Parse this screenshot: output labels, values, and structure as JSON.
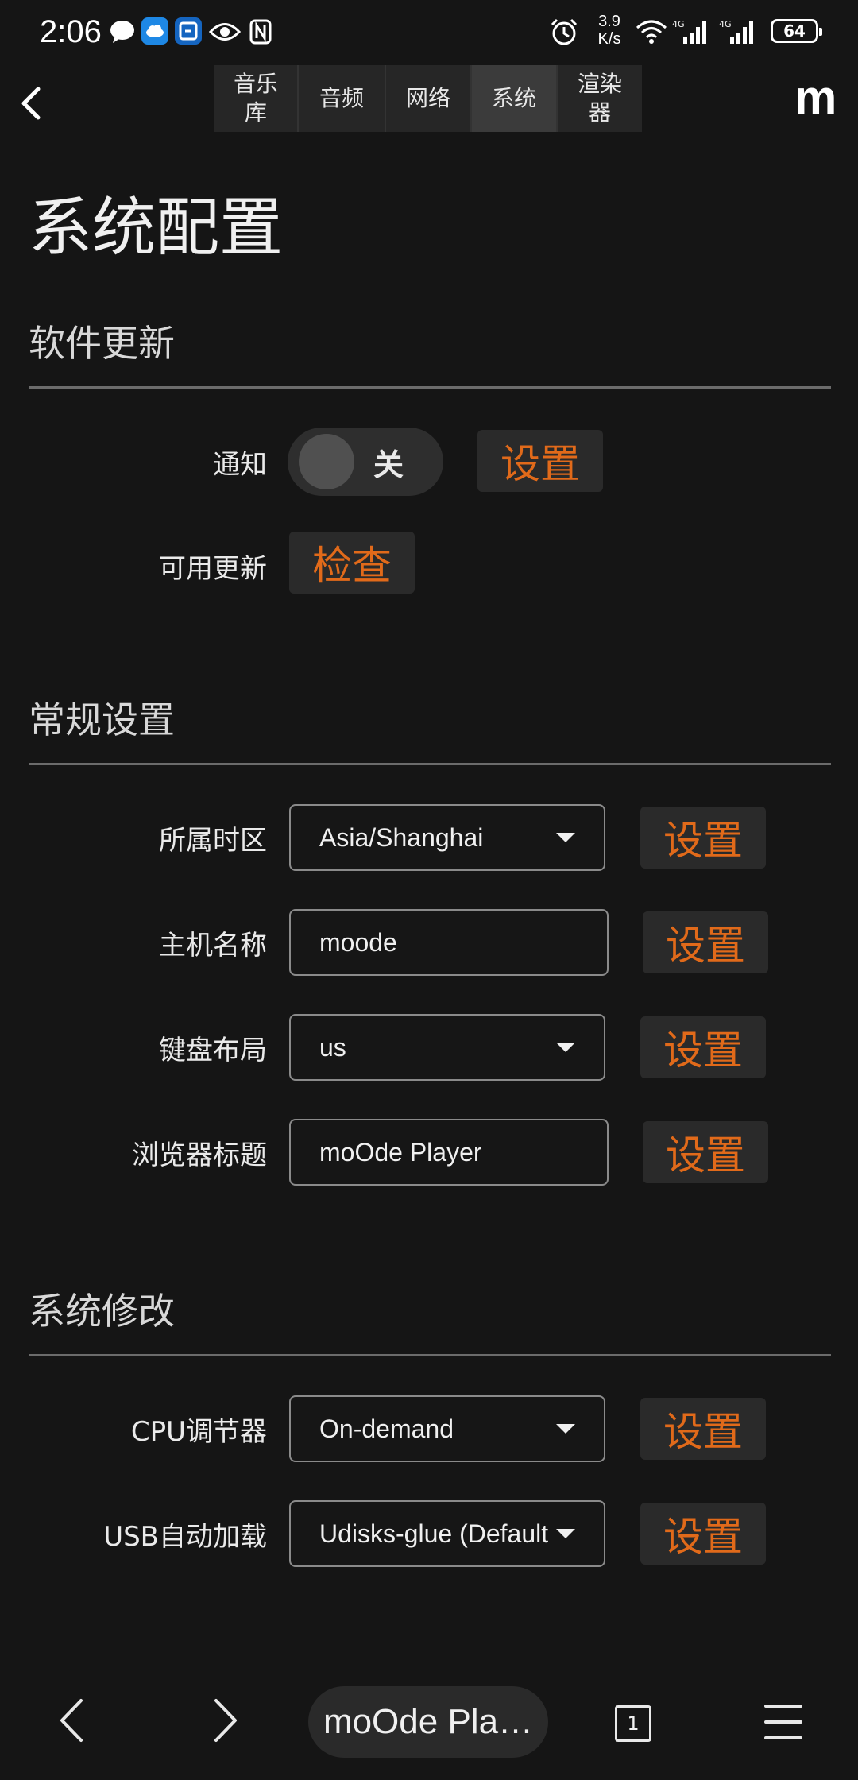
{
  "status_bar": {
    "time": "2:06",
    "net_speed_value": "3.9",
    "net_speed_unit": "K/s",
    "battery": "64",
    "icons": [
      "chat-bubble-icon",
      "cloud-app-icon",
      "browser-app-icon",
      "eye-icon",
      "nfc-icon",
      "alarm-icon",
      "wifi-icon",
      "signal-4g-icon",
      "signal-4g-icon",
      "battery-icon"
    ]
  },
  "header": {
    "tabs": [
      {
        "label_line1": "音乐",
        "label_line2": "库"
      },
      {
        "label": "音频"
      },
      {
        "label": "网络"
      },
      {
        "label": "系统",
        "active": true
      },
      {
        "label_line1": "渲染",
        "label_line2": "器"
      }
    ],
    "logo": "m"
  },
  "page": {
    "title": "系统配置",
    "sections": {
      "software_update": {
        "title": "软件更新",
        "notify_label": "通知",
        "notify_toggle": "关",
        "notify_button": "设置",
        "available_label": "可用更新",
        "check_button": "检查"
      },
      "general": {
        "title": "常规设置",
        "timezone_label": "所属时区",
        "timezone_value": "Asia/Shanghai",
        "timezone_button": "设置",
        "hostname_label": "主机名称",
        "hostname_value": "moode",
        "hostname_button": "设置",
        "keyboard_label": "键盘布局",
        "keyboard_value": "us",
        "keyboard_button": "设置",
        "browser_title_label": "浏览器标题",
        "browser_title_value": "moOde Player",
        "browser_title_button": "设置"
      },
      "system_mods": {
        "title": "系统修改",
        "cpu_label": "CPU调节器",
        "cpu_value": "On-demand",
        "cpu_button": "设置",
        "usb_label": "USB自动加载",
        "usb_value": "Udisks-glue (Default)",
        "usb_button": "设置"
      }
    }
  },
  "bottom_bar": {
    "url_title": "moOde Pla…",
    "tab_count": "1"
  },
  "colors": {
    "background": "#151515",
    "accent": "#e16a1a",
    "button_bg": "#2a2a2a",
    "divider": "#6b6b6b"
  }
}
